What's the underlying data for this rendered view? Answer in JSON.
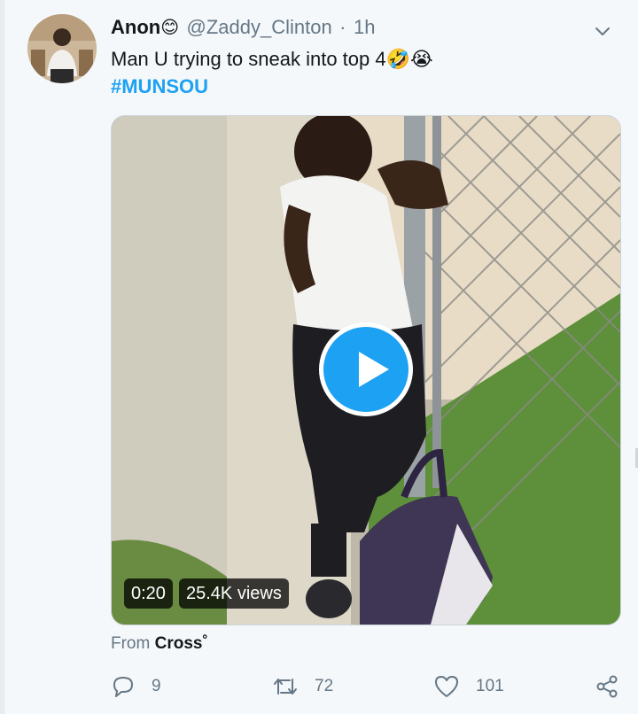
{
  "tweet": {
    "display_name": "Anon",
    "name_emoji": "😊",
    "handle": "@Zaddy_Clinton",
    "separator": "·",
    "time": "1h",
    "text": "Man U trying to sneak into top 4🤣😭",
    "hashtag": "#MUNSOU",
    "from_prefix": "From",
    "from_source": "Cross˚"
  },
  "video": {
    "duration": "0:20",
    "views": "25.4K views"
  },
  "actions": {
    "reply_count": "9",
    "retweet_count": "72",
    "like_count": "101"
  },
  "colors": {
    "accent": "#1da1f2",
    "text_secondary": "#657786",
    "background": "#f5f8fa"
  },
  "icons": [
    "chevron-down-icon",
    "play-icon",
    "reply-icon",
    "retweet-icon",
    "like-icon",
    "share-icon"
  ]
}
